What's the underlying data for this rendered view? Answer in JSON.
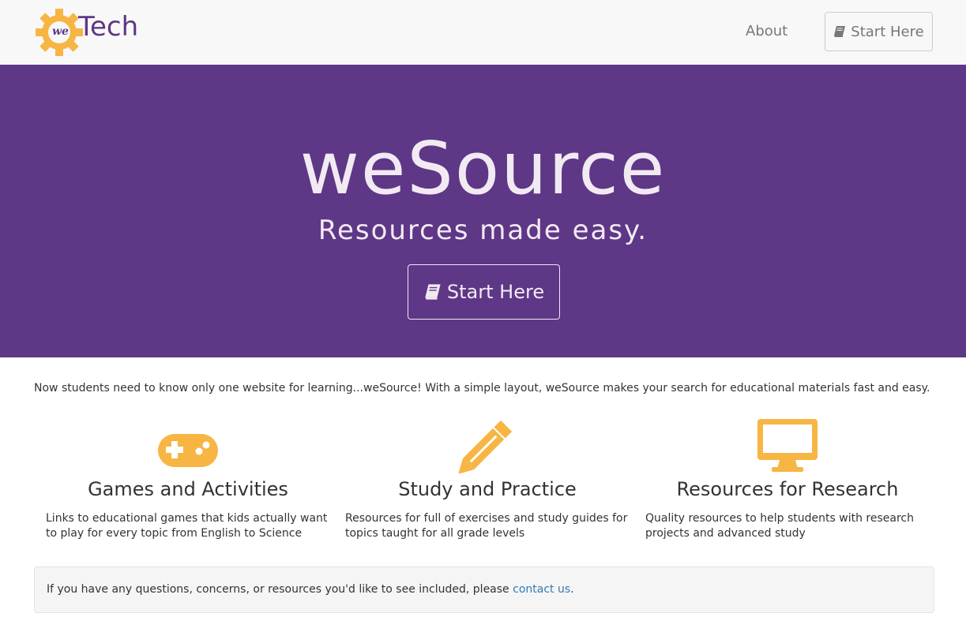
{
  "brand": {
    "logo_prefix": "we",
    "logo_text": "Tech"
  },
  "nav": {
    "about": "About",
    "start_here": "Start Here"
  },
  "hero": {
    "title": "weSource",
    "subtitle": "Resources made easy.",
    "button": "Start Here"
  },
  "intro": "Now students need to know only one website for learning...weSource! With a simple layout, weSource makes your search for educational materials fast and easy.",
  "features": [
    {
      "icon": "gamepad-icon",
      "title": "Games and Activities",
      "desc": "Links to educational games that kids actually want to play for every topic from English to Science"
    },
    {
      "icon": "pencil-icon",
      "title": "Study and Practice",
      "desc": "Resources for full of exercises and study guides for topics taught for all grade levels"
    },
    {
      "icon": "desktop-icon",
      "title": "Resources for Research",
      "desc": "Quality resources to help students with research projects and advanced study"
    }
  ],
  "footer_well": {
    "text_before": "If you have any questions, concerns, or resources you'd like to see included, please ",
    "link": "contact us",
    "text_after": "."
  },
  "colors": {
    "brand_purple": "#5e3787",
    "accent_orange": "#f7b544",
    "link_blue": "#337ab7",
    "hero_text": "#f2eaf2"
  }
}
